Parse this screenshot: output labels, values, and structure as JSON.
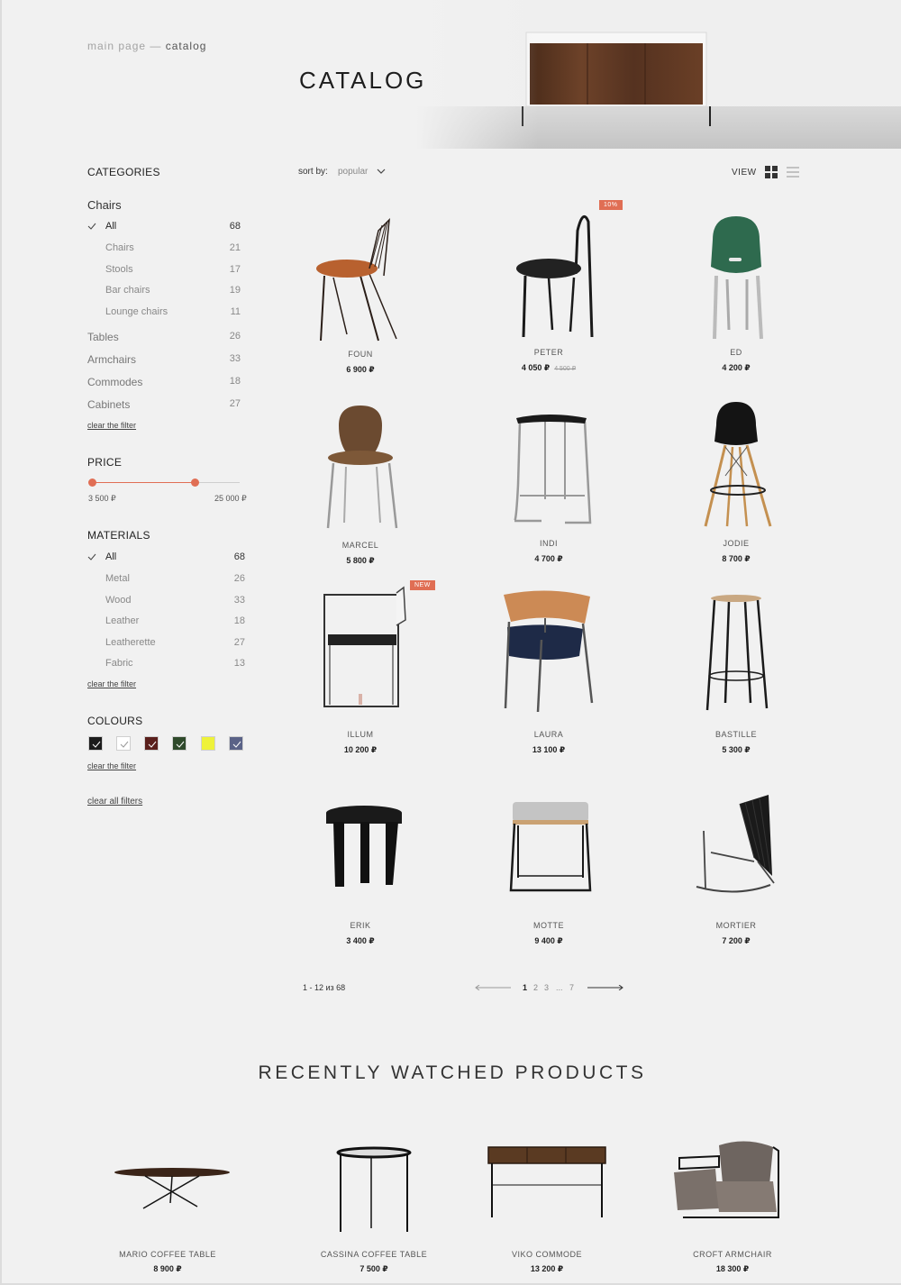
{
  "header": {
    "breadcrumb": {
      "home": "main page",
      "separator": " — ",
      "current": "catalog"
    },
    "title": "CATALOG"
  },
  "sidebar": {
    "categories_heading": "CATEGORIES",
    "chairs_group": "Chairs",
    "chair_items": [
      {
        "label": "All",
        "count": "68",
        "active": true
      },
      {
        "label": "Chairs",
        "count": "21"
      },
      {
        "label": "Stools",
        "count": "17"
      },
      {
        "label": "Bar chairs",
        "count": "19"
      },
      {
        "label": "Lounge chairs",
        "count": "11"
      }
    ],
    "main_categories": [
      {
        "label": "Tables",
        "count": "26"
      },
      {
        "label": "Armchairs",
        "count": "33"
      },
      {
        "label": "Commodes",
        "count": "18"
      },
      {
        "label": "Cabinets",
        "count": "27"
      }
    ],
    "clear_filter": "clear the filter",
    "price_heading": "PRICE",
    "price_min": "3 500 ₽",
    "price_max": "25 000 ₽",
    "materials_heading": "MATERIALS",
    "materials": [
      {
        "label": "All",
        "count": "68",
        "active": true
      },
      {
        "label": "Metal",
        "count": "26"
      },
      {
        "label": "Wood",
        "count": "33"
      },
      {
        "label": "Leather",
        "count": "18"
      },
      {
        "label": "Leatherette",
        "count": "27"
      },
      {
        "label": "Fabric",
        "count": "13"
      }
    ],
    "colours_heading": "COLOURS",
    "colours": [
      "#1c1c1c",
      "#ffffff",
      "#5a1f1c",
      "#2f4a2b",
      "#eef23a",
      "#5a6287"
    ],
    "clear_all": "clear all filters"
  },
  "toolbar": {
    "sort_label": "sort by:",
    "sort_value": "popular",
    "view_label": "VIEW"
  },
  "products": [
    {
      "name": "FOUN",
      "price": "6 900 ₽"
    },
    {
      "name": "PETER",
      "price": "4 050 ₽",
      "old_price": "4 500 ₽",
      "badge": "10%"
    },
    {
      "name": "ED",
      "price": "4 200 ₽"
    },
    {
      "name": "MARCEL",
      "price": "5 800 ₽"
    },
    {
      "name": "INDI",
      "price": "4 700 ₽"
    },
    {
      "name": "JODIE",
      "price": "8 700 ₽"
    },
    {
      "name": "ILLUM",
      "price": "10 200 ₽",
      "badge": "NEW"
    },
    {
      "name": "LAURA",
      "price": "13 100 ₽"
    },
    {
      "name": "BASTILLE",
      "price": "5 300 ₽"
    },
    {
      "name": "ERIK",
      "price": "3 400 ₽"
    },
    {
      "name": "MOTTE",
      "price": "9 400 ₽"
    },
    {
      "name": "MORTIER",
      "price": "7 200 ₽"
    }
  ],
  "pagination": {
    "info": "1 - 12 из 68",
    "pages": [
      "1",
      "2",
      "3",
      "...",
      "7"
    ]
  },
  "recent": {
    "title": "RECENTLY WATCHED PRODUCTS",
    "items": [
      {
        "name": "MARIO COFFEE TABLE",
        "price": "8 900 ₽"
      },
      {
        "name": "CASSINA COFFEE TABLE",
        "price": "7 500 ₽"
      },
      {
        "name": "VIKO COMMODE",
        "price": "13 200 ₽"
      },
      {
        "name": "CROFT ARMCHAIR",
        "price": "18 300 ₽"
      }
    ]
  }
}
